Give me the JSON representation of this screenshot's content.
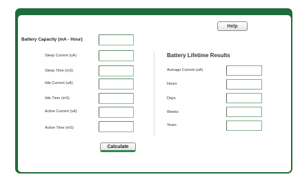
{
  "help_label": "Help",
  "capacity_label": "Battery Capacity (mA - Hour)",
  "inputs": [
    {
      "label": "Sleep Current (uA)"
    },
    {
      "label": "Sleep Time (mS)"
    },
    {
      "label": "Idle Current (uA)"
    },
    {
      "label": "Idle Time (mS)"
    },
    {
      "label": "Active Current (uA)"
    },
    {
      "label": "Active Time (mS)"
    }
  ],
  "calculate_label": "Calculate",
  "results": {
    "heading": "Battery Lifetime Results",
    "fields": [
      {
        "label": "Average Current (uA)"
      },
      {
        "label": "Hours"
      },
      {
        "label": "Days"
      },
      {
        "label": "Weeks"
      },
      {
        "label": "Years"
      }
    ]
  },
  "colors": {
    "frame": "#1f6b3a",
    "accent": "#2d8a4f"
  }
}
